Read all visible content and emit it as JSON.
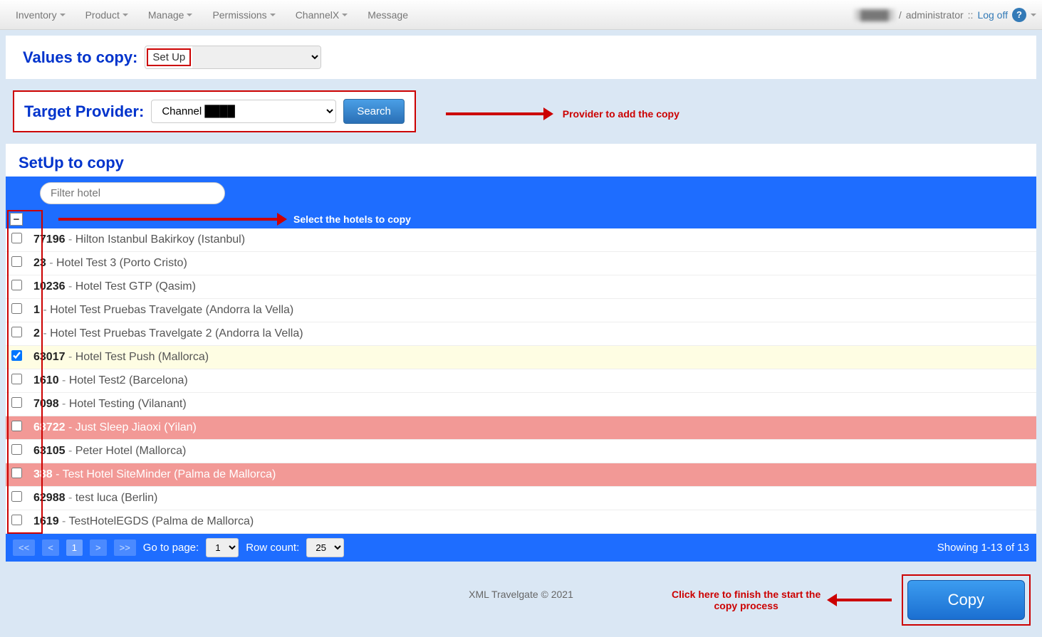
{
  "nav": {
    "items": [
      "Inventory",
      "Product",
      "Manage",
      "Permissions",
      "ChannelX",
      "Message"
    ],
    "user_obscured": "████",
    "role": "administrator",
    "separator": "::",
    "logoff": "Log off"
  },
  "values_to_copy": {
    "label": "Values to copy:",
    "selected": "Set Up"
  },
  "target_provider": {
    "label": "Target Provider:",
    "selected": "Channel ████",
    "search_btn": "Search",
    "annotation": "Provider to add the copy"
  },
  "setup_section": {
    "heading": "SetUp to copy",
    "filter_placeholder": "Filter hotel",
    "select_annotation": "Select the hotels to copy"
  },
  "hotels": [
    {
      "id": "77196",
      "name": "Hilton Istanbul Bakirkoy (Istanbul)",
      "checked": false,
      "state": ""
    },
    {
      "id": "23",
      "name": "Hotel Test 3 (Porto Cristo)",
      "checked": false,
      "state": ""
    },
    {
      "id": "10236",
      "name": "Hotel Test GTP (Qasim)",
      "checked": false,
      "state": ""
    },
    {
      "id": "1",
      "name": "Hotel Test Pruebas Travelgate (Andorra la Vella)",
      "checked": false,
      "state": ""
    },
    {
      "id": "2",
      "name": "Hotel Test Pruebas Travelgate 2 (Andorra la Vella)",
      "checked": false,
      "state": ""
    },
    {
      "id": "63017",
      "name": "Hotel Test Push (Mallorca)",
      "checked": true,
      "state": "sel"
    },
    {
      "id": "1610",
      "name": "Hotel Test2 (Barcelona)",
      "checked": false,
      "state": ""
    },
    {
      "id": "7098",
      "name": "Hotel Testing (Vilanant)",
      "checked": false,
      "state": ""
    },
    {
      "id": "68722",
      "name": "Just Sleep Jiaoxi (Yilan)",
      "checked": false,
      "state": "red"
    },
    {
      "id": "63105",
      "name": "Peter Hotel (Mallorca)",
      "checked": false,
      "state": ""
    },
    {
      "id": "388",
      "name": "Test Hotel SiteMinder (Palma de Mallorca)",
      "checked": false,
      "state": "red"
    },
    {
      "id": "62988",
      "name": "test luca (Berlin)",
      "checked": false,
      "state": ""
    },
    {
      "id": "1619",
      "name": "TestHotelEGDS (Palma de Mallorca)",
      "checked": false,
      "state": ""
    }
  ],
  "pagination": {
    "first": "<<",
    "prev": "<",
    "page": "1",
    "next": ">",
    "last": ">>",
    "go_label": "Go to page:",
    "go_value": "1",
    "rowcount_label": "Row count:",
    "rowcount_value": "25",
    "showing": "Showing 1-13 of 13"
  },
  "footer": {
    "text": "XML Travelgate © 2021",
    "copy_annotation": "Click here to finish the start the copy process",
    "copy_btn": "Copy"
  }
}
